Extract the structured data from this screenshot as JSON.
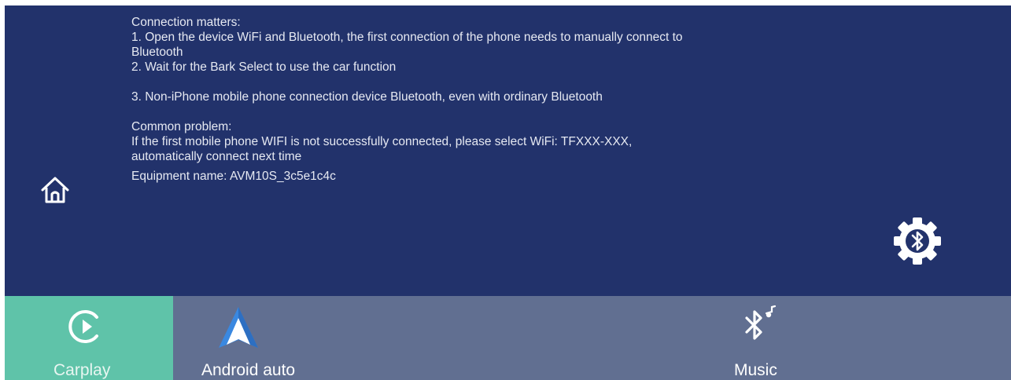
{
  "info": {
    "line1": "Connection matters:",
    "line2": "1. Open the device WiFi and Bluetooth, the first connection of the phone needs to manually connect to",
    "line3": "Bluetooth",
    "line4": "2. Wait for the Bark Select to use the car function",
    "line5": "3. Non-iPhone mobile phone connection device Bluetooth, even with ordinary Bluetooth",
    "line6": "Common problem:",
    "line7": "If the first mobile phone WIFI is not successfully connected, please select WiFi: TFXXX-XXX,",
    "line8": "automatically connect next time",
    "line9": "Equipment name:  AVM10S_3c5e1c4c"
  },
  "icons": {
    "home": "home-icon",
    "settings": "bluetooth-settings-gear-icon",
    "carplay": "carplay-play-icon",
    "android": "android-auto-icon",
    "music": "bluetooth-music-icon"
  },
  "tabs": {
    "carplay": "Carplay",
    "android_auto": "Android auto",
    "music": "Music"
  },
  "colors": {
    "main_bg": "#22326b",
    "bottom_bar_bg": "#616f91",
    "active_tab_bg": "#5fc3a9"
  }
}
